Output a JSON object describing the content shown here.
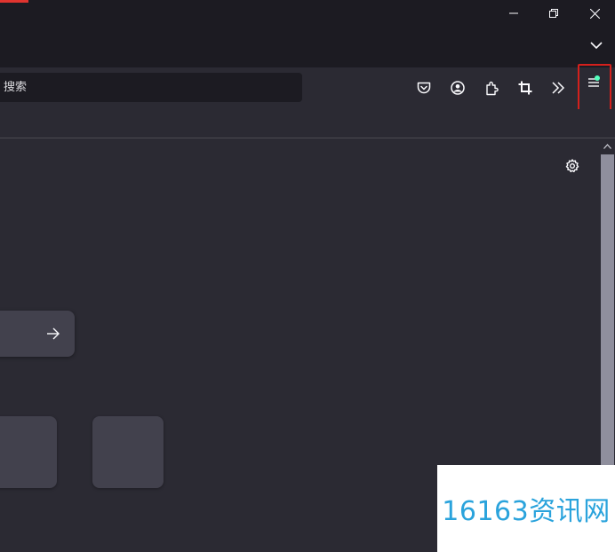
{
  "window": {
    "minimize_icon": "minimize-icon",
    "restore_icon": "restore-icon",
    "close_icon": "close-icon",
    "list_all_tabs_icon": "chevron-down-icon"
  },
  "navbar": {
    "url_placeholder": "搜索",
    "buttons": [
      "pocket-icon",
      "account-icon",
      "extensions-icon",
      "screenshot-crop-icon",
      "overflow-chevrons-icon"
    ],
    "menu_icon": "hamburger-menu-icon",
    "menu_badge_color": "#54ffbd"
  },
  "newtab": {
    "settings_icon": "gear-icon",
    "search_arrow_icon": "arrow-right-icon"
  },
  "watermark": {
    "text": "16163资讯网"
  },
  "colors": {
    "titlebar": "#1c1b22",
    "toolbar": "#2b2a33",
    "highlight": "#d4201c",
    "watermark_text": "#2aa3dc"
  }
}
